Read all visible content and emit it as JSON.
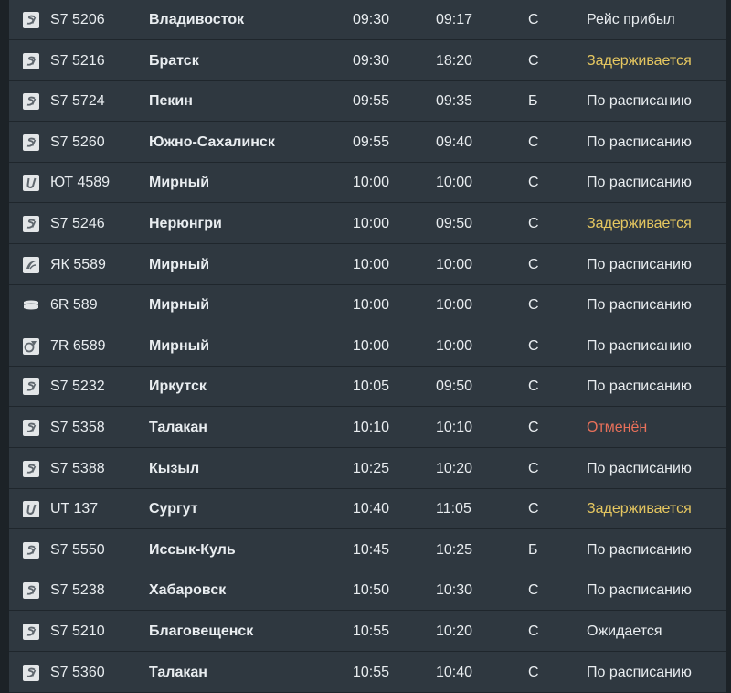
{
  "colors": {
    "background": "#2f3840",
    "text": "#e9edf0",
    "delayed": "#e6c760",
    "cancelled": "#e8705a"
  },
  "flights": [
    {
      "airline_icon": "s7-logo-icon",
      "flight": "S7 5206",
      "destination": "Владивосток",
      "scheduled": "09:30",
      "actual": "09:17",
      "terminal": "С",
      "status": "Рейс прибыл",
      "status_type": "normal"
    },
    {
      "airline_icon": "s7-logo-icon",
      "flight": "S7 5216",
      "destination": "Братск",
      "scheduled": "09:30",
      "actual": "18:20",
      "terminal": "С",
      "status": "Задерживается",
      "status_type": "delayed"
    },
    {
      "airline_icon": "s7-logo-icon",
      "flight": "S7 5724",
      "destination": "Пекин",
      "scheduled": "09:55",
      "actual": "09:35",
      "terminal": "Б",
      "status": "По расписанию",
      "status_type": "normal"
    },
    {
      "airline_icon": "s7-logo-icon",
      "flight": "S7 5260",
      "destination": "Южно-Сахалинск",
      "scheduled": "09:55",
      "actual": "09:40",
      "terminal": "С",
      "status": "По расписанию",
      "status_type": "normal"
    },
    {
      "airline_icon": "utair-logo-icon",
      "flight": "ЮТ 4589",
      "destination": "Мирный",
      "scheduled": "10:00",
      "actual": "10:00",
      "terminal": "С",
      "status": "По расписанию",
      "status_type": "normal"
    },
    {
      "airline_icon": "s7-logo-icon",
      "flight": "S7 5246",
      "destination": "Нерюнгри",
      "scheduled": "10:00",
      "actual": "09:50",
      "terminal": "С",
      "status": "Задерживается",
      "status_type": "delayed"
    },
    {
      "airline_icon": "yakutia-logo-icon",
      "flight": "ЯК 5589",
      "destination": "Мирный",
      "scheduled": "10:00",
      "actual": "10:00",
      "terminal": "С",
      "status": "По расписанию",
      "status_type": "normal"
    },
    {
      "airline_icon": "alrosa-logo-icon",
      "flight": "6R 589",
      "destination": "Мирный",
      "scheduled": "10:00",
      "actual": "10:00",
      "terminal": "С",
      "status": "По расписанию",
      "status_type": "normal"
    },
    {
      "airline_icon": "polar-airlines-logo-icon",
      "flight": "7R 6589",
      "destination": "Мирный",
      "scheduled": "10:00",
      "actual": "10:00",
      "terminal": "С",
      "status": "По расписанию",
      "status_type": "normal"
    },
    {
      "airline_icon": "s7-logo-icon",
      "flight": "S7 5232",
      "destination": "Иркутск",
      "scheduled": "10:05",
      "actual": "09:50",
      "terminal": "С",
      "status": "По расписанию",
      "status_type": "normal"
    },
    {
      "airline_icon": "s7-logo-icon",
      "flight": "S7 5358",
      "destination": "Талакан",
      "scheduled": "10:10",
      "actual": "10:10",
      "terminal": "С",
      "status": "Отменён",
      "status_type": "cancelled"
    },
    {
      "airline_icon": "s7-logo-icon",
      "flight": "S7 5388",
      "destination": "Кызыл",
      "scheduled": "10:25",
      "actual": "10:20",
      "terminal": "С",
      "status": "По расписанию",
      "status_type": "normal"
    },
    {
      "airline_icon": "utair-logo-icon",
      "flight": "UT 137",
      "destination": "Сургут",
      "scheduled": "10:40",
      "actual": "11:05",
      "terminal": "С",
      "status": "Задерживается",
      "status_type": "delayed"
    },
    {
      "airline_icon": "s7-logo-icon",
      "flight": "S7 5550",
      "destination": "Иссык-Куль",
      "scheduled": "10:45",
      "actual": "10:25",
      "terminal": "Б",
      "status": "По расписанию",
      "status_type": "normal"
    },
    {
      "airline_icon": "s7-logo-icon",
      "flight": "S7 5238",
      "destination": "Хабаровск",
      "scheduled": "10:50",
      "actual": "10:30",
      "terminal": "С",
      "status": "По расписанию",
      "status_type": "normal"
    },
    {
      "airline_icon": "s7-logo-icon",
      "flight": "S7 5210",
      "destination": "Благовещенск",
      "scheduled": "10:55",
      "actual": "10:20",
      "terminal": "С",
      "status": "Ожидается",
      "status_type": "normal"
    },
    {
      "airline_icon": "s7-logo-icon",
      "flight": "S7 5360",
      "destination": "Талакан",
      "scheduled": "10:55",
      "actual": "10:40",
      "terminal": "С",
      "status": "По расписанию",
      "status_type": "normal"
    }
  ]
}
